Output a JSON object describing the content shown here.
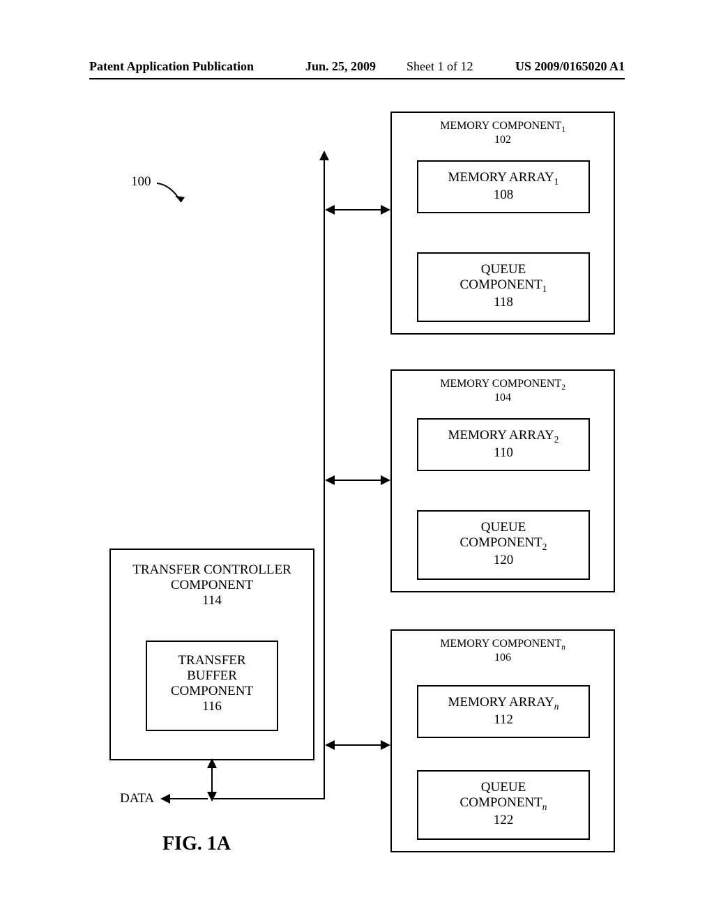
{
  "header": {
    "left": "Patent Application Publication",
    "center": "Jun. 25, 2009",
    "sheet": "Sheet 1 of 12",
    "right": "US 2009/0165020 A1"
  },
  "ref": {
    "num100": "100"
  },
  "controller": {
    "title_l1": "TRANSFER CONTROLLER",
    "title_l2": "COMPONENT",
    "num": "114",
    "buffer_l1": "TRANSFER",
    "buffer_l2": "BUFFER",
    "buffer_l3": "COMPONENT",
    "buffer_num": "116"
  },
  "mem1": {
    "title": "MEMORY COMPONENT",
    "sub": "1",
    "num": "102",
    "array_title": "MEMORY ARRAY",
    "array_num": "108",
    "queue_l1": "QUEUE",
    "queue_l2": "COMPONENT",
    "queue_num": "118"
  },
  "mem2": {
    "title": "MEMORY COMPONENT",
    "sub": "2",
    "num": "104",
    "array_title": "MEMORY ARRAY",
    "array_num": "110",
    "queue_l1": "QUEUE",
    "queue_l2": "COMPONENT",
    "queue_num": "120"
  },
  "memn": {
    "title": "MEMORY COMPONENT",
    "sub": "n",
    "num": "106",
    "array_title": "MEMORY ARRAY",
    "array_num": "112",
    "queue_l1": "QUEUE",
    "queue_l2": "COMPONENT",
    "queue_num": "122"
  },
  "data_label": "DATA",
  "fig_label": "FIG. 1A"
}
